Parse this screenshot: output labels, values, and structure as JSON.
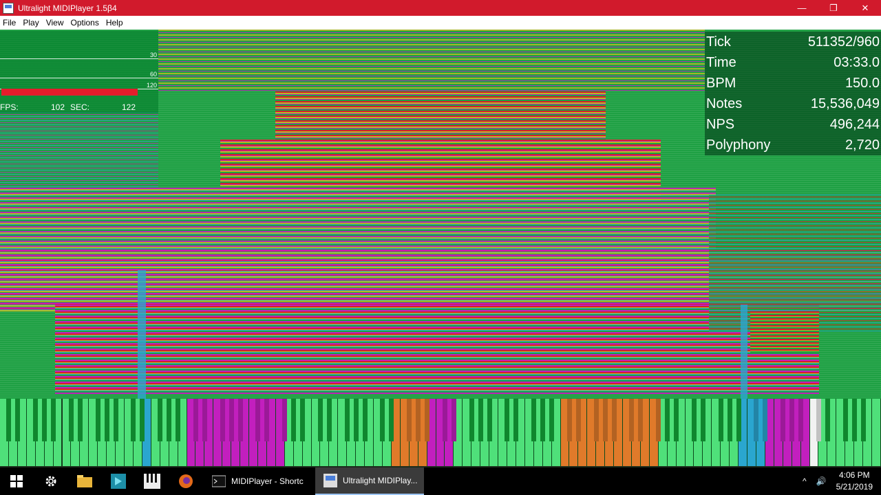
{
  "window": {
    "title": "Ultralight MIDIPlayer 1.5β4",
    "minimize_glyph": "—",
    "maximize_glyph": "❐",
    "close_glyph": "✕"
  },
  "menu": [
    "File",
    "Play",
    "View",
    "Options",
    "Help"
  ],
  "fps_panel": {
    "grid_labels": [
      "30",
      "60",
      "120"
    ],
    "fps_label": "FPS:",
    "fps_value": "102",
    "sec_label": "SEC:",
    "sec_value": "122"
  },
  "stats": [
    {
      "label": "Tick",
      "value": "511352/960"
    },
    {
      "label": "Time",
      "value": "03:33.0"
    },
    {
      "label": "BPM",
      "value": "150.0"
    },
    {
      "label": "Notes",
      "value": "15,536,049"
    },
    {
      "label": "NPS",
      "value": "496,244"
    },
    {
      "label": "Polyphony",
      "value": "2,720"
    }
  ],
  "colors": {
    "background_green": "#1ea043",
    "magenta": "#c21fbe",
    "red": "#d31f2c",
    "yellow": "#b8b822",
    "blue": "#2aa6cf",
    "orange": "#e07a2a",
    "key_green": "#4fe07a"
  },
  "taskbar": {
    "icons": [
      "windows-start-icon",
      "settings-gear-icon",
      "file-explorer-icon",
      "app-pinned-icon",
      "midi-keys-icon",
      "firefox-icon"
    ],
    "tasks": [
      {
        "label": "MIDIPlayer - Shortc",
        "active": false
      },
      {
        "label": "Ultralight MIDIPlay...",
        "active": true
      }
    ],
    "tray_chevron": "^",
    "volume_glyph": "🔊",
    "time": "4:06 PM",
    "date": "5/21/2019"
  }
}
